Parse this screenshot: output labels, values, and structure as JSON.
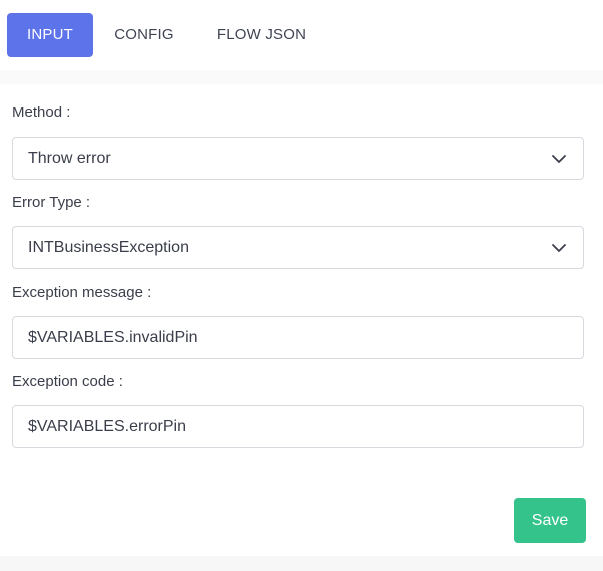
{
  "tabs": {
    "input": "INPUT",
    "config": "CONFIG",
    "flow_json": "FLOW JSON",
    "active": "INPUT"
  },
  "form": {
    "method": {
      "label": "Method :",
      "value": "Throw error"
    },
    "error_type": {
      "label": "Error Type :",
      "value": "INTBusinessException"
    },
    "exception_message": {
      "label": "Exception message :",
      "value": "$VARIABLES.invalidPin"
    },
    "exception_code": {
      "label": "Exception code :",
      "value": "$VARIABLES.errorPin"
    }
  },
  "actions": {
    "save_label": "Save"
  },
  "colors": {
    "accent": "#5d73ea",
    "save": "#33c38b",
    "border": "#d6d9de",
    "text": "#3a3e4a"
  },
  "icons": {
    "dropdown": "chevron-down-icon"
  }
}
